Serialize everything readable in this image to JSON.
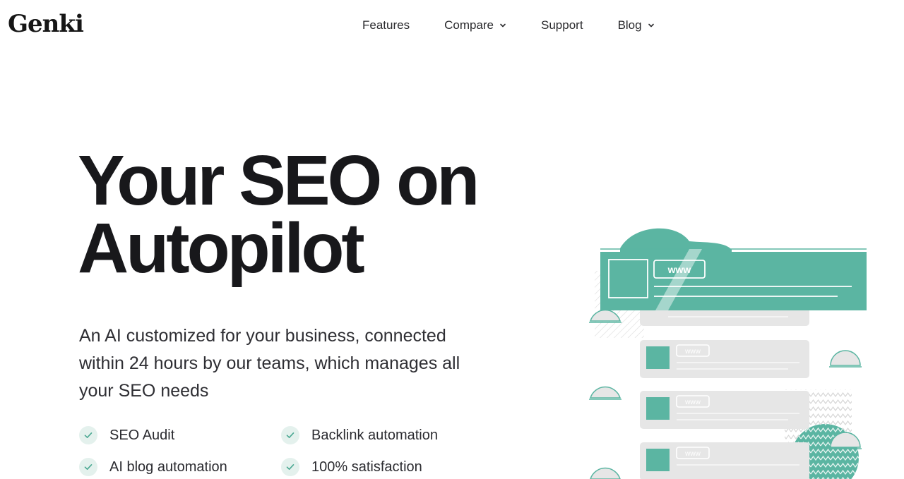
{
  "brand": {
    "name": "Genki"
  },
  "nav": {
    "items": [
      {
        "label": "Features",
        "dropdown": false
      },
      {
        "label": "Compare",
        "dropdown": true
      },
      {
        "label": "Support",
        "dropdown": false
      },
      {
        "label": "Blog",
        "dropdown": true
      }
    ]
  },
  "hero": {
    "title_line1": "Your SEO on",
    "title_line2": "Autopilot",
    "subtitle": "An AI customized for your business, connected within 24 hours by our teams, which manages all your SEO needs"
  },
  "features": [
    {
      "label": "SEO Audit",
      "icon": "check-icon"
    },
    {
      "label": "Backlink automation",
      "icon": "check-icon"
    },
    {
      "label": "AI blog automation",
      "icon": "check-icon"
    },
    {
      "label": "100% satisfaction",
      "icon": "check-icon"
    }
  ],
  "illustration": {
    "www_label": "www",
    "accent_color": "#5bb5a2",
    "card_color": "#e6e6e6"
  },
  "colors": {
    "accent": "#5bb5a2",
    "text": "#18181b",
    "check_bg": "#e4f1ed"
  }
}
